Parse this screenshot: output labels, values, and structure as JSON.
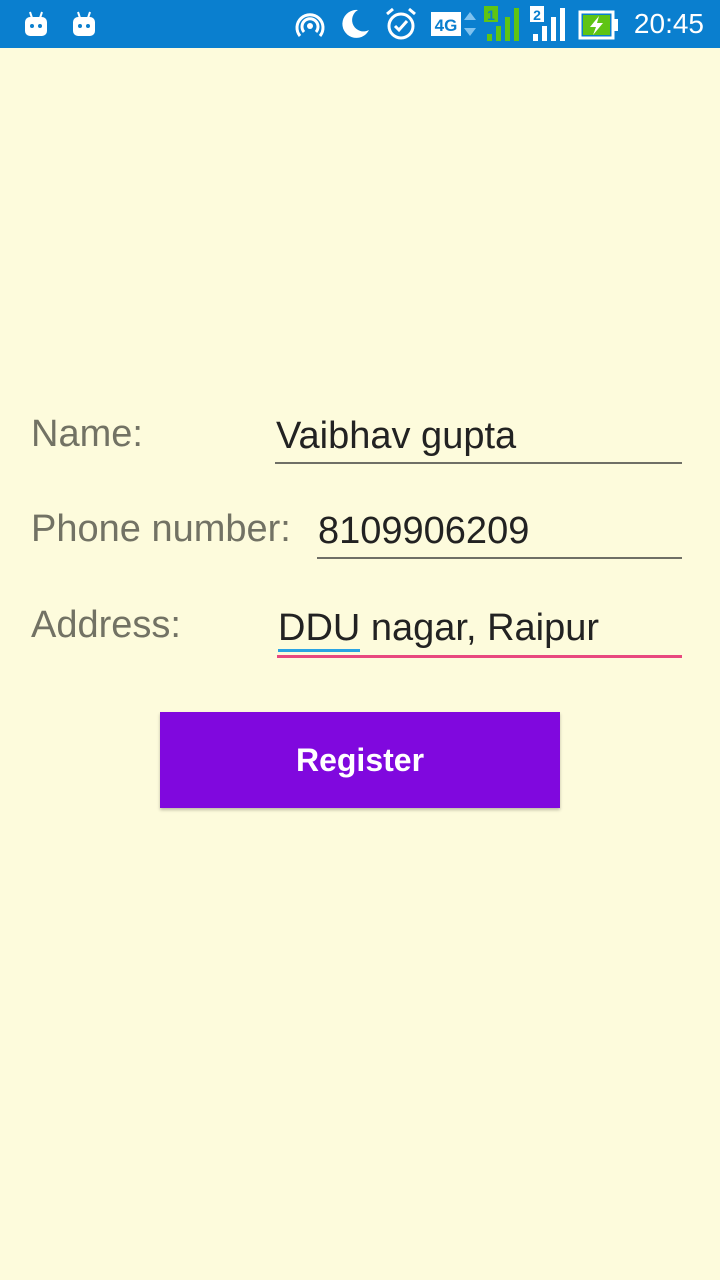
{
  "status_bar": {
    "time": "20:45",
    "network_type": "4G",
    "sim1": "1",
    "sim2": "2",
    "left_icons": [
      "android-icon",
      "android-icon"
    ],
    "right_icons": [
      "hotspot-icon",
      "moon-icon",
      "alarm-icon",
      "network-4g-icon",
      "signal-sim1-icon",
      "signal-sim2-icon",
      "battery-charging-icon"
    ],
    "background_color": "#0a7fcf"
  },
  "form": {
    "name": {
      "label": "Name:",
      "value": "Vaibhav gupta"
    },
    "phone": {
      "label": "Phone number:",
      "value": "8109906209"
    },
    "address": {
      "label": "Address:",
      "value_underlined": "DDU",
      "value_rest": " nagar, Raipur",
      "focused": true
    }
  },
  "register_button": {
    "label": "Register"
  },
  "colors": {
    "page_background": "#fdfbdc",
    "button": "#8008de",
    "focus_underline": "#e8487f",
    "spellcheck_underline": "#2aa4e3",
    "label_text": "#727264"
  }
}
